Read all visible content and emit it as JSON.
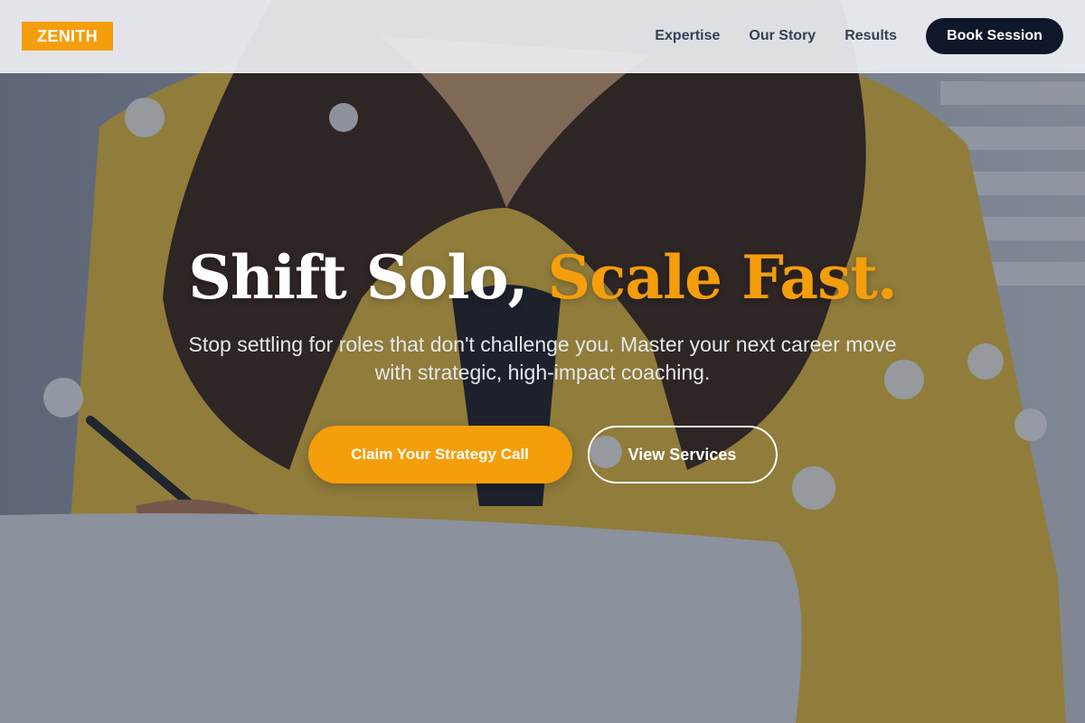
{
  "nav": {
    "logo": "ZENITH",
    "links": [
      "Expertise",
      "Our Story",
      "Results"
    ],
    "cta": "Book Session"
  },
  "hero": {
    "title_main": "Shift Solo, ",
    "title_accent": "Scale Fast.",
    "subtitle": "Stop settling for roles that don't challenge you. Master your next career move with strategic, high-impact coaching.",
    "primary_button": "Claim Your Strategy Call",
    "secondary_button": "View Services"
  },
  "colors": {
    "accent": "#f59e0b",
    "dark": "#0f172a",
    "nav_text": "#334155"
  }
}
